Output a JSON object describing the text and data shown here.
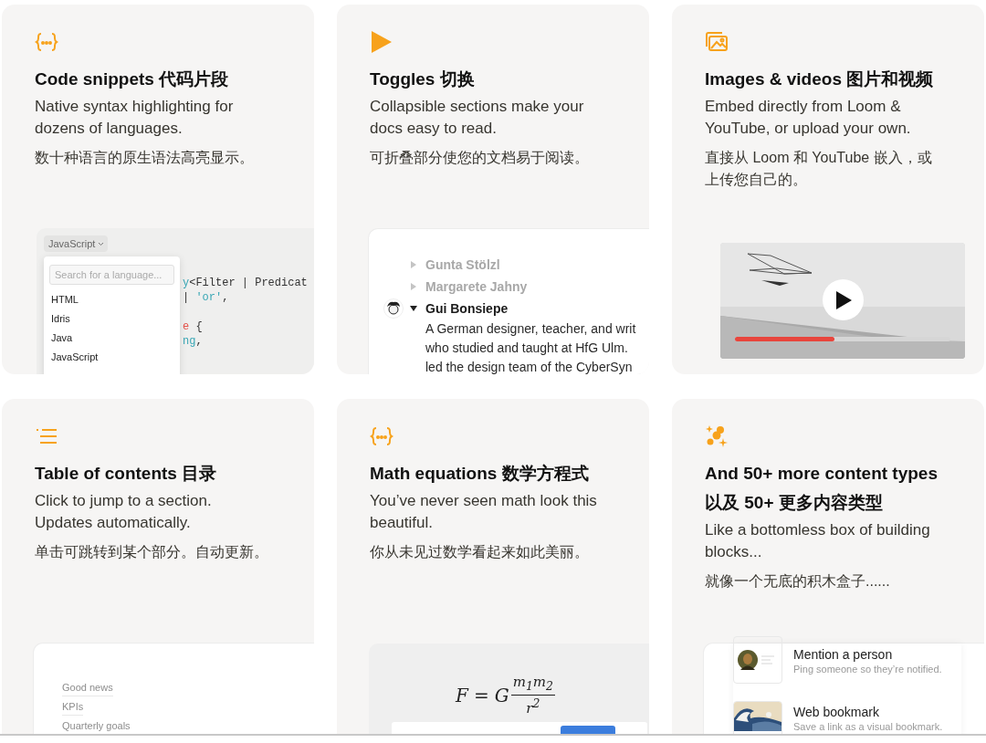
{
  "cards": [
    {
      "kind": "code",
      "title": [
        "Code snippets 代码片段"
      ],
      "description": "Native syntax highlighting for dozens of languages.",
      "description_zh": "数十种语言的原生语法高亮显示。",
      "preview": {
        "language_button": "JavaScript",
        "search_placeholder": "Search for a language...",
        "languages": [
          "HTML",
          "Idris",
          "Java",
          "JavaScript"
        ],
        "code_lines": [
          {
            "tokens": [
              {
                "text": "y",
                "kind": "keyword"
              },
              {
                "text": "<Filter | Predicat",
                "kind": "plain"
              }
            ]
          },
          {
            "tokens": [
              {
                "text": "| ",
                "kind": "plain"
              },
              {
                "text": "'or'",
                "kind": "string"
              },
              {
                "text": ",",
                "kind": "plain"
              }
            ]
          },
          {
            "tokens": [
              {
                "text": "e",
                "kind": "accent"
              },
              {
                "text": " {",
                "kind": "plain"
              }
            ]
          },
          {
            "tokens": [
              {
                "text": "ng",
                "kind": "keyword"
              },
              {
                "text": ",",
                "kind": "plain"
              }
            ]
          }
        ]
      }
    },
    {
      "kind": "toggles",
      "title": [
        "Toggles 切换"
      ],
      "description": "Collapsible sections make your docs easy to read.",
      "description_zh": "可折叠部分使您的文档易于阅读。",
      "preview": {
        "toggles": [
          {
            "label": "Gunta Stölzl",
            "expanded": false
          },
          {
            "label": "Margarete Jahny",
            "expanded": false
          },
          {
            "label": "Gui Bonsiepe",
            "expanded": true,
            "body": [
              "A German designer, teacher, and writ",
              "who studied and taught at HfG Ulm.",
              "led the design team of the CyberSyn"
            ]
          }
        ]
      }
    },
    {
      "kind": "video",
      "title": [
        "Images & videos 图片和视频"
      ],
      "description": "Embed directly from Loom & YouTube, or upload your own.",
      "description_zh": "直接从 Loom 和 YouTube 嵌入，或上传您自己的。",
      "preview": {
        "progress": {
          "level": 0.46
        }
      }
    },
    {
      "kind": "toc",
      "title": [
        "Table of contents 目录"
      ],
      "description": "Click to jump to a section. Updates automatically.",
      "description_zh": "单击可跳转到某个部分。自动更新。",
      "preview": {
        "links": [
          "Good news",
          "KPIs",
          "Quarterly goals"
        ]
      }
    },
    {
      "kind": "math",
      "title": [
        "Math equations 数学方程式"
      ],
      "description": "You’ve never seen math look this beautiful.",
      "description_zh": "你从未见过数学看起来如此美丽。",
      "preview": {
        "equation": {
          "left": "F",
          "operator": "=",
          "constant": "G",
          "numerator": "m$_{1}$m$_{2}$",
          "denominator": "r$^{2}$"
        }
      }
    },
    {
      "kind": "blocks",
      "title": [
        "And 50+ more content types",
        "以及 50+ 更多内容类型"
      ],
      "description": "Like a bottomless box of building blocks...",
      "description_zh": "就像一个无底的积木盒子......",
      "preview": {
        "items": [
          {
            "kind": "person",
            "title": "Mention a person",
            "subtitle": "Ping someone so they’re notified."
          },
          {
            "kind": "bookmark",
            "title": "Web bookmark",
            "subtitle": "Save a link as a visual bookmark."
          }
        ]
      }
    }
  ]
}
